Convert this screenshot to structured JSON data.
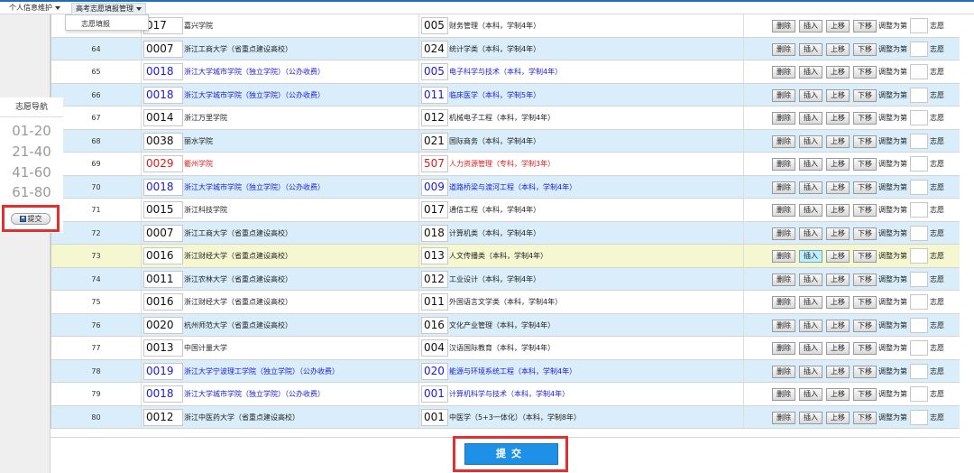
{
  "menus": {
    "personal_info": "个人信息维护",
    "gaokao_manage": "高考志愿填报管理",
    "dropdown_item": "志愿填报"
  },
  "nav": {
    "title": "志愿导航",
    "items": [
      "01-20",
      "21-40",
      "41-60",
      "61-80"
    ],
    "submit_label": "提交"
  },
  "actions": {
    "delete": "删除",
    "insert": "插入",
    "up": "上移",
    "down": "下移",
    "adjust_prefix": "调整为第",
    "adjust_suffix": "志愿"
  },
  "rows": [
    {
      "no": "",
      "school_code": "017",
      "school_name": "嘉兴学院",
      "major_code": "005",
      "major_name": "财务管理（本科，学制4年）",
      "style": "white",
      "text": ""
    },
    {
      "no": "64",
      "school_code": "0007",
      "school_name": "浙江工商大学（省重点建设高校）",
      "major_code": "024",
      "major_name": "统计学类（本科，学制4年）",
      "style": "blue",
      "text": ""
    },
    {
      "no": "65",
      "school_code": "0018",
      "school_name": "浙江大学城市学院（独立学院）（公办收费）",
      "major_code": "005",
      "major_name": "电子科学与技术（本科，学制4年）",
      "style": "white",
      "text": "blue-t"
    },
    {
      "no": "66",
      "school_code": "0018",
      "school_name": "浙江大学城市学院（独立学院）（公办收费）",
      "major_code": "011",
      "major_name": "临床医学（本科，学制5年）",
      "style": "blue",
      "text": "blue-t"
    },
    {
      "no": "67",
      "school_code": "0014",
      "school_name": "浙江万里学院",
      "major_code": "012",
      "major_name": "机械电子工程（本科，学制4年）",
      "style": "white",
      "text": ""
    },
    {
      "no": "68",
      "school_code": "0038",
      "school_name": "丽水学院",
      "major_code": "021",
      "major_name": "国际商务（本科，学制4年）",
      "style": "blue",
      "text": ""
    },
    {
      "no": "69",
      "school_code": "0029",
      "school_name": "衢州学院",
      "major_code": "507",
      "major_name": "人力资源管理（专科，学制3年）",
      "style": "white",
      "text": "red-t"
    },
    {
      "no": "70",
      "school_code": "0018",
      "school_name": "浙江大学城市学院（独立学院）（公办收费）",
      "major_code": "009",
      "major_name": "道路桥梁与渡河工程（本科，学制4年）",
      "style": "blue",
      "text": "blue-t"
    },
    {
      "no": "71",
      "school_code": "0015",
      "school_name": "浙江科技学院",
      "major_code": "017",
      "major_name": "通信工程（本科，学制4年）",
      "style": "white",
      "text": ""
    },
    {
      "no": "72",
      "school_code": "0007",
      "school_name": "浙江工商大学（省重点建设高校）",
      "major_code": "018",
      "major_name": "计算机类（本科，学制4年）",
      "style": "blue",
      "text": ""
    },
    {
      "no": "73",
      "school_code": "0016",
      "school_name": "浙江财经大学（省重点建设高校）",
      "major_code": "013",
      "major_name": "人文传播类（本科，学制4年）",
      "style": "yellow",
      "text": ""
    },
    {
      "no": "74",
      "school_code": "0011",
      "school_name": "浙江农林大学（省重点建设高校）",
      "major_code": "012",
      "major_name": "工业设计（本科，学制4年）",
      "style": "blue",
      "text": ""
    },
    {
      "no": "75",
      "school_code": "0016",
      "school_name": "浙江财经大学（省重点建设高校）",
      "major_code": "011",
      "major_name": "外国语言文学类（本科，学制4年）",
      "style": "white",
      "text": ""
    },
    {
      "no": "76",
      "school_code": "0020",
      "school_name": "杭州师范大学（省重点建设高校）",
      "major_code": "016",
      "major_name": "文化产业管理（本科，学制4年）",
      "style": "blue",
      "text": ""
    },
    {
      "no": "77",
      "school_code": "0013",
      "school_name": "中国计量大学",
      "major_code": "004",
      "major_name": "汉语国际教育（本科，学制4年）",
      "style": "white",
      "text": ""
    },
    {
      "no": "78",
      "school_code": "0019",
      "school_name": "浙江大学宁波理工学院（独立学院）（公办收费）",
      "major_code": "020",
      "major_name": "能源与环境系统工程（本科，学制4年）",
      "style": "blue",
      "text": "blue-t"
    },
    {
      "no": "79",
      "school_code": "0018",
      "school_name": "浙江大学城市学院（独立学院）（公办收费）",
      "major_code": "001",
      "major_name": "计算机科学与技术（本科，学制4年）",
      "style": "white",
      "text": "blue-t"
    },
    {
      "no": "80",
      "school_code": "0012",
      "school_name": "浙江中医药大学（省重点建设高校）",
      "major_code": "001",
      "major_name": "中医学（5+3一体化）（本科，学制8年）",
      "style": "blue",
      "text": ""
    }
  ],
  "main_submit": "提交",
  "colors": {
    "accent": "#1e6fb8",
    "submit_blue": "#1e90e8",
    "highlight_red": "#e52e2e",
    "row_blue": "#d9eefa",
    "row_yellow": "#f4f7cf"
  }
}
